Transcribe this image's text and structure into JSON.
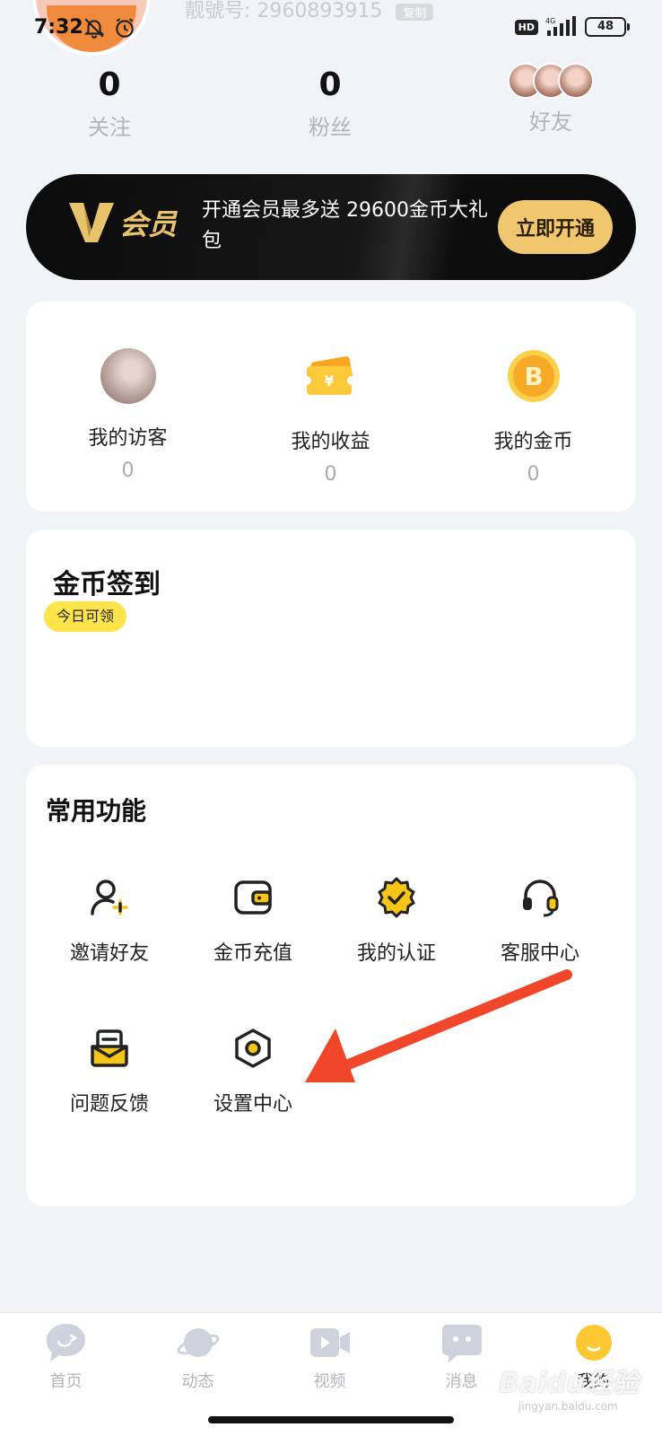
{
  "status_bar": {
    "time": "7:32",
    "network": "4G",
    "hd": "HD",
    "battery": "48"
  },
  "profile": {
    "user_id_partial": "靓號号: 2960893915",
    "badge": "复制"
  },
  "stats": {
    "follow": {
      "value": "0",
      "label": "关注"
    },
    "fans": {
      "value": "0",
      "label": "粉丝"
    },
    "friends": {
      "label": "好友"
    }
  },
  "vip": {
    "logo_text": "会员",
    "promo": "开通会员最多送 29600金币大礼包",
    "cta": "立即开通",
    "accent": "#f0c66f"
  },
  "quick_stats": [
    {
      "label": "我的访客",
      "value": "0",
      "icon": "visitor-avatar"
    },
    {
      "label": "我的收益",
      "value": "0",
      "icon": "ticket-icon"
    },
    {
      "label": "我的金币",
      "value": "0",
      "icon": "gold-coin-icon"
    }
  ],
  "checkin": {
    "title": "金币签到",
    "pill": "今日可领"
  },
  "functions": {
    "title": "常用功能",
    "items": [
      {
        "label": "邀请好友",
        "icon": "add-user-icon"
      },
      {
        "label": "金币充值",
        "icon": "wallet-icon"
      },
      {
        "label": "我的认证",
        "icon": "verified-badge-icon"
      },
      {
        "label": "客服中心",
        "icon": "headset-icon"
      },
      {
        "label": "问题反馈",
        "icon": "feedback-mail-icon"
      },
      {
        "label": "设置中心",
        "icon": "settings-hexagon-icon"
      }
    ]
  },
  "bottom_nav": [
    {
      "label": "首页",
      "icon": "chat-bubble-icon",
      "active": false
    },
    {
      "label": "动态",
      "icon": "planet-icon",
      "active": false
    },
    {
      "label": "视频",
      "icon": "video-camera-icon",
      "active": false
    },
    {
      "label": "消息",
      "icon": "message-icon",
      "active": false
    },
    {
      "label": "我的",
      "icon": "profile-face-icon",
      "active": true
    }
  ],
  "watermark": {
    "text": "Baidu经验",
    "sub": "jingyan.baidu.com"
  }
}
